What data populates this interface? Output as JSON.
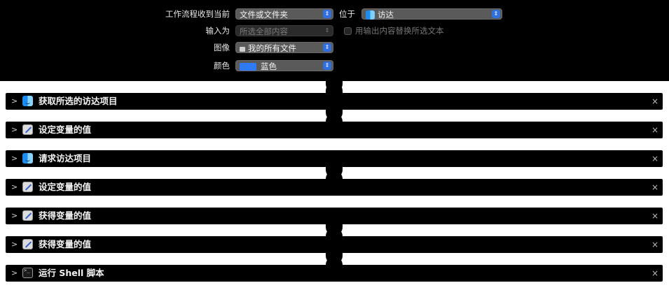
{
  "header": {
    "receives_label": "工作流程收到当前",
    "receives_value": "文件或文件夹",
    "in_label": "位于",
    "in_value": "访达",
    "input_label": "输入为",
    "input_value": "所选全部内容",
    "replace_label": "用输出内容替换所选文本",
    "image_label": "图像",
    "image_value": "我的所有文件",
    "color_label": "颜色",
    "color_value": "蓝色",
    "color_hex": "#2f7bf6",
    "stepper_glyph": "⇕"
  },
  "actions": [
    {
      "title": "获取所选的访达项目",
      "icon": "finder-icon"
    },
    {
      "title": "设定变量的值",
      "icon": "variable-icon"
    },
    {
      "title": "请求访达项目",
      "icon": "finder-icon"
    },
    {
      "title": "设定变量的值",
      "icon": "variable-icon"
    },
    {
      "title": "获得变量的值",
      "icon": "variable-icon"
    },
    {
      "title": "获得变量的值",
      "icon": "variable-icon"
    },
    {
      "title": "运行 Shell 脚本",
      "icon": "terminal-icon"
    }
  ],
  "glyphs": {
    "chevron": ">",
    "close": "×"
  }
}
